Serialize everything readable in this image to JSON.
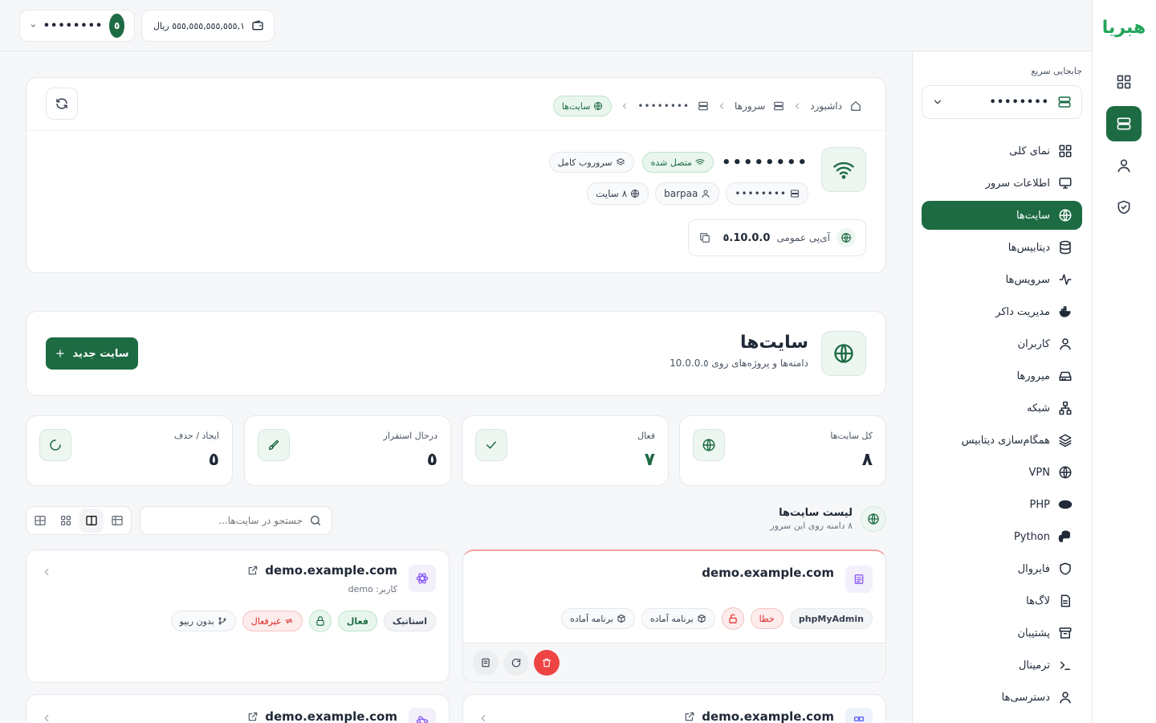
{
  "rail": {
    "logo": "هبریا",
    "buttons": [
      "grid-icon",
      "server-icon",
      "user-icon",
      "shield-icon"
    ]
  },
  "topbar": {
    "user_masked": "••••••••",
    "avatar_initial": "٥",
    "wallet": "۱,٥٥٥,٥٥٥,٥٥٥,٥٥٥ ریال"
  },
  "sidebar": {
    "quick_label": "جابجایی سریع",
    "quick_value": "••••••••",
    "items": [
      {
        "label": "نمای کلی",
        "icon": "grid-icon"
      },
      {
        "label": "اطلاعات سرور",
        "icon": "monitor-icon"
      },
      {
        "label": "سایت‌ها",
        "icon": "globe-icon"
      },
      {
        "label": "دیتابیس‌ها",
        "icon": "database-icon"
      },
      {
        "label": "سرویس‌ها",
        "icon": "activity-icon"
      },
      {
        "label": "مدیریت داکر",
        "icon": "docker-icon"
      },
      {
        "label": "کاربران",
        "icon": "user-icon"
      },
      {
        "label": "میرورها",
        "icon": "drive-icon"
      },
      {
        "label": "شبکه",
        "icon": "network-icon"
      },
      {
        "label": "همگام‌سازی دیتابیس",
        "icon": "layers-icon"
      },
      {
        "label": "VPN",
        "icon": "globe-lock-icon"
      },
      {
        "label": "PHP",
        "icon": "php-icon"
      },
      {
        "label": "Python",
        "icon": "python-icon"
      },
      {
        "label": "فایروال",
        "icon": "shield-icon"
      },
      {
        "label": "لاگ‌ها",
        "icon": "file-icon"
      },
      {
        "label": "پشتیبان",
        "icon": "archive-icon"
      },
      {
        "label": "ترمینال",
        "icon": "terminal-icon"
      },
      {
        "label": "دسترسی‌ها",
        "icon": "user-icon"
      }
    ]
  },
  "breadcrumb": {
    "dashboard": "داشبورد",
    "servers": "سرورها",
    "server": "••••••••",
    "current": "سایت‌ها"
  },
  "server": {
    "name": "••••••••",
    "status": "متصل شده",
    "type": "سروروب کامل",
    "host": "••••••••",
    "user": "barpaa",
    "sites": "۸ سایت",
    "ip_label": "آی‌پی عمومی",
    "ip": "10.0.0.٥"
  },
  "sites_header": {
    "title": "سایت‌ها",
    "subtitle": "دامنه‌ها و پروژه‌های روی 10.0.0.٥",
    "new_button": "سایت جدید"
  },
  "stats": [
    {
      "label": "کل سایت‌ها",
      "value": "۸",
      "icon": "globe-icon"
    },
    {
      "label": "فعال",
      "value": "۷",
      "icon": "check-icon"
    },
    {
      "label": "درحال استقرار",
      "value": "٥",
      "icon": "rocket-icon"
    },
    {
      "label": "ایجاد / حذف",
      "value": "٥",
      "icon": "loader-icon"
    }
  ],
  "list": {
    "title": "لیست سایت‌ها",
    "subtitle": "۸ دامنه روی این سرور",
    "search_placeholder": "جستجو در سایت‌ها..."
  },
  "cards": [
    {
      "domain": "demo.example.com",
      "chips": {
        "app": "phpMyAdmin",
        "error": "خطا",
        "ready1": "برنامه آماده",
        "ready2": "برنامه آماده"
      }
    },
    {
      "domain": "demo.example.com",
      "user": "کاربر: demo",
      "chips": {
        "static": "استاتیک",
        "active": "فعال",
        "inactive": "غیرفعال",
        "norepo": "بدون ریپو"
      }
    },
    {
      "domain": "demo.example.com"
    },
    {
      "domain": "demo.example.com"
    }
  ],
  "colors": {
    "brand": "#1d6b43",
    "error": "#ef4444",
    "accent": "#22a55a"
  }
}
